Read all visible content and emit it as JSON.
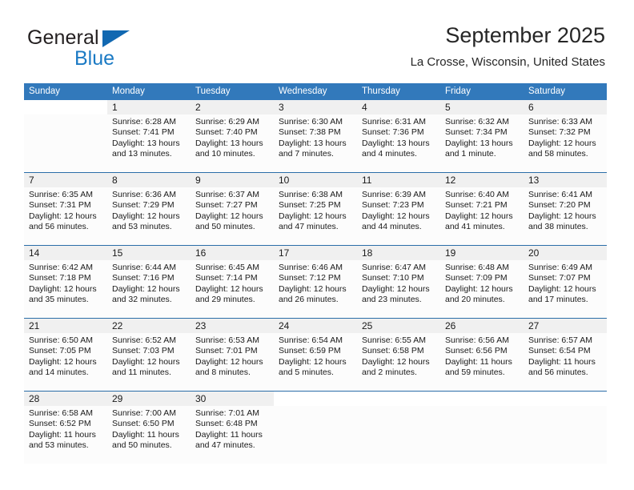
{
  "brand": {
    "name_part1": "General",
    "name_part2": "Blue",
    "triangle_icon": "blue-triangle-icon",
    "accent_color": "#1b7ac4"
  },
  "header": {
    "title": "September 2025",
    "subtitle": "La Crosse, Wisconsin, United States"
  },
  "calendar": {
    "header_bg": "#3279bb",
    "divider_color": "#2b6ea8",
    "date_band_bg": "#f0f0f0",
    "weekday_headers": [
      "Sunday",
      "Monday",
      "Tuesday",
      "Wednesday",
      "Thursday",
      "Friday",
      "Saturday"
    ],
    "weeks": [
      [
        {
          "day": "",
          "lines": []
        },
        {
          "day": "1",
          "lines": [
            "Sunrise: 6:28 AM",
            "Sunset: 7:41 PM",
            "Daylight: 13 hours",
            "and 13 minutes."
          ]
        },
        {
          "day": "2",
          "lines": [
            "Sunrise: 6:29 AM",
            "Sunset: 7:40 PM",
            "Daylight: 13 hours",
            "and 10 minutes."
          ]
        },
        {
          "day": "3",
          "lines": [
            "Sunrise: 6:30 AM",
            "Sunset: 7:38 PM",
            "Daylight: 13 hours",
            "and 7 minutes."
          ]
        },
        {
          "day": "4",
          "lines": [
            "Sunrise: 6:31 AM",
            "Sunset: 7:36 PM",
            "Daylight: 13 hours",
            "and 4 minutes."
          ]
        },
        {
          "day": "5",
          "lines": [
            "Sunrise: 6:32 AM",
            "Sunset: 7:34 PM",
            "Daylight: 13 hours",
            "and 1 minute."
          ]
        },
        {
          "day": "6",
          "lines": [
            "Sunrise: 6:33 AM",
            "Sunset: 7:32 PM",
            "Daylight: 12 hours",
            "and 58 minutes."
          ]
        }
      ],
      [
        {
          "day": "7",
          "lines": [
            "Sunrise: 6:35 AM",
            "Sunset: 7:31 PM",
            "Daylight: 12 hours",
            "and 56 minutes."
          ]
        },
        {
          "day": "8",
          "lines": [
            "Sunrise: 6:36 AM",
            "Sunset: 7:29 PM",
            "Daylight: 12 hours",
            "and 53 minutes."
          ]
        },
        {
          "day": "9",
          "lines": [
            "Sunrise: 6:37 AM",
            "Sunset: 7:27 PM",
            "Daylight: 12 hours",
            "and 50 minutes."
          ]
        },
        {
          "day": "10",
          "lines": [
            "Sunrise: 6:38 AM",
            "Sunset: 7:25 PM",
            "Daylight: 12 hours",
            "and 47 minutes."
          ]
        },
        {
          "day": "11",
          "lines": [
            "Sunrise: 6:39 AM",
            "Sunset: 7:23 PM",
            "Daylight: 12 hours",
            "and 44 minutes."
          ]
        },
        {
          "day": "12",
          "lines": [
            "Sunrise: 6:40 AM",
            "Sunset: 7:21 PM",
            "Daylight: 12 hours",
            "and 41 minutes."
          ]
        },
        {
          "day": "13",
          "lines": [
            "Sunrise: 6:41 AM",
            "Sunset: 7:20 PM",
            "Daylight: 12 hours",
            "and 38 minutes."
          ]
        }
      ],
      [
        {
          "day": "14",
          "lines": [
            "Sunrise: 6:42 AM",
            "Sunset: 7:18 PM",
            "Daylight: 12 hours",
            "and 35 minutes."
          ]
        },
        {
          "day": "15",
          "lines": [
            "Sunrise: 6:44 AM",
            "Sunset: 7:16 PM",
            "Daylight: 12 hours",
            "and 32 minutes."
          ]
        },
        {
          "day": "16",
          "lines": [
            "Sunrise: 6:45 AM",
            "Sunset: 7:14 PM",
            "Daylight: 12 hours",
            "and 29 minutes."
          ]
        },
        {
          "day": "17",
          "lines": [
            "Sunrise: 6:46 AM",
            "Sunset: 7:12 PM",
            "Daylight: 12 hours",
            "and 26 minutes."
          ]
        },
        {
          "day": "18",
          "lines": [
            "Sunrise: 6:47 AM",
            "Sunset: 7:10 PM",
            "Daylight: 12 hours",
            "and 23 minutes."
          ]
        },
        {
          "day": "19",
          "lines": [
            "Sunrise: 6:48 AM",
            "Sunset: 7:09 PM",
            "Daylight: 12 hours",
            "and 20 minutes."
          ]
        },
        {
          "day": "20",
          "lines": [
            "Sunrise: 6:49 AM",
            "Sunset: 7:07 PM",
            "Daylight: 12 hours",
            "and 17 minutes."
          ]
        }
      ],
      [
        {
          "day": "21",
          "lines": [
            "Sunrise: 6:50 AM",
            "Sunset: 7:05 PM",
            "Daylight: 12 hours",
            "and 14 minutes."
          ]
        },
        {
          "day": "22",
          "lines": [
            "Sunrise: 6:52 AM",
            "Sunset: 7:03 PM",
            "Daylight: 12 hours",
            "and 11 minutes."
          ]
        },
        {
          "day": "23",
          "lines": [
            "Sunrise: 6:53 AM",
            "Sunset: 7:01 PM",
            "Daylight: 12 hours",
            "and 8 minutes."
          ]
        },
        {
          "day": "24",
          "lines": [
            "Sunrise: 6:54 AM",
            "Sunset: 6:59 PM",
            "Daylight: 12 hours",
            "and 5 minutes."
          ]
        },
        {
          "day": "25",
          "lines": [
            "Sunrise: 6:55 AM",
            "Sunset: 6:58 PM",
            "Daylight: 12 hours",
            "and 2 minutes."
          ]
        },
        {
          "day": "26",
          "lines": [
            "Sunrise: 6:56 AM",
            "Sunset: 6:56 PM",
            "Daylight: 11 hours",
            "and 59 minutes."
          ]
        },
        {
          "day": "27",
          "lines": [
            "Sunrise: 6:57 AM",
            "Sunset: 6:54 PM",
            "Daylight: 11 hours",
            "and 56 minutes."
          ]
        }
      ],
      [
        {
          "day": "28",
          "lines": [
            "Sunrise: 6:58 AM",
            "Sunset: 6:52 PM",
            "Daylight: 11 hours",
            "and 53 minutes."
          ]
        },
        {
          "day": "29",
          "lines": [
            "Sunrise: 7:00 AM",
            "Sunset: 6:50 PM",
            "Daylight: 11 hours",
            "and 50 minutes."
          ]
        },
        {
          "day": "30",
          "lines": [
            "Sunrise: 7:01 AM",
            "Sunset: 6:48 PM",
            "Daylight: 11 hours",
            "and 47 minutes."
          ]
        },
        {
          "day": "",
          "lines": []
        },
        {
          "day": "",
          "lines": []
        },
        {
          "day": "",
          "lines": []
        },
        {
          "day": "",
          "lines": []
        }
      ]
    ]
  }
}
